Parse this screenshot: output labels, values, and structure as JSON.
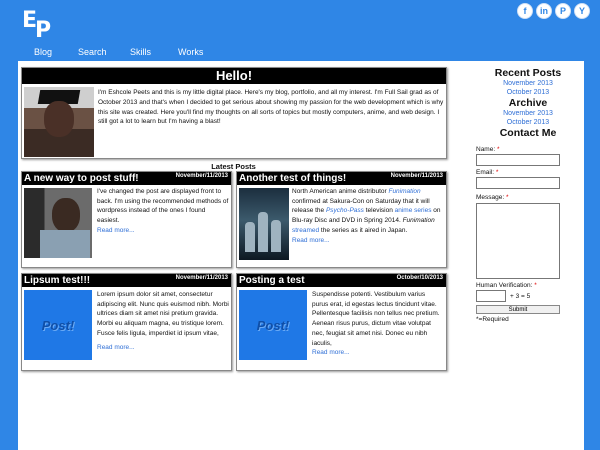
{
  "logo": {
    "letter1": "E",
    "letter2": "P"
  },
  "social": [
    {
      "icon": "facebook-icon",
      "glyph": "f"
    },
    {
      "icon": "linkedin-icon",
      "glyph": "in"
    },
    {
      "icon": "pinterest-icon",
      "glyph": "P"
    },
    {
      "icon": "yahoo-icon",
      "glyph": "Y"
    }
  ],
  "nav": [
    "Blog",
    "Search",
    "Skills",
    "Works"
  ],
  "hello": {
    "title": "Hello!",
    "text": "I'm Eshcole Peets and this is my little digital place. Here's my blog, portfolio, and all my interest. I'm Full Sail grad as of October 2013 and that's when I decided to get serious about showing my passion for the web development which is why this site was created. Here you'll find my thoughts on all sorts of topics but mostly computers, anime, and web design. I still got a lot to learn but I'm having a blast!"
  },
  "latest_title": "Latest Posts",
  "posts": [
    {
      "title": "A new way to post stuff!",
      "date": "November/11/2013",
      "text": "I've changed the post are displayed front to back. I'm using the recommended methods of wordpress instead of the ones I found easiest.",
      "more": "Read more..."
    },
    {
      "title": "Another test of things!",
      "date": "November/11/2013",
      "t1": "North American anime distributor ",
      "l1": "Funimation",
      "t2": " confirmed at Sakura-Con on Saturday that it will release the ",
      "l2": "Psycho-Pass",
      "t3": " television ",
      "l3": "anime series",
      "t4": " on Blu-ray Disc and DVD in Spring 2014. ",
      "t5": "Funimation",
      "t6": " ",
      "l4": "streamed",
      "t7": " the series as it aired in Japan.",
      "more": "Read more..."
    },
    {
      "title": "Lipsum test!!!",
      "date": "November/11/2013",
      "thumb_text": "Post!",
      "text": "Lorem ipsum dolor sit amet, consectetur adipiscing elit. Nunc quis euismod nibh. Morbi ultrices diam sit amet nisi pretium gravida. Morbi eu aliquam magna, eu tristique lorem. Fusce felis ligula, imperdiet id ipsum vitae,",
      "more": "Read more..."
    },
    {
      "title": "Posting a test",
      "date": "October/10/2013",
      "thumb_text": "Post!",
      "text": "Suspendisse potenti. Vestibulum varius purus erat, id egestas lectus tincidunt vitae. Pellentesque facilisis non tellus nec pretium. Aenean risus purus, dictum vitae volutpat nec, feugiat sit amet nisi. Donec eu nibh iaculis,",
      "more": "Read more..."
    }
  ],
  "sidebar": {
    "recent_title": "Recent Posts",
    "recent": [
      "November 2013",
      "October 2013"
    ],
    "archive_title": "Archive",
    "archive": [
      "November 2013",
      "October 2013"
    ],
    "contact_title": "Contact Me"
  },
  "form": {
    "name_label": "Name:",
    "email_label": "Email:",
    "message_label": "Message:",
    "verify_label": "Human Verification:",
    "star": "*",
    "equation": "+ 3 = 5",
    "submit": "Submit",
    "required_note": "*=Required"
  }
}
